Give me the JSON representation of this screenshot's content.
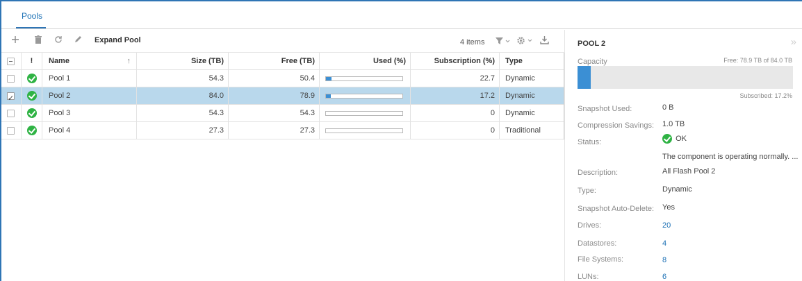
{
  "tabs": [
    {
      "label": "Pools"
    }
  ],
  "toolbar": {
    "expand_pool_label": "Expand Pool",
    "items_count": "4 items"
  },
  "table": {
    "headers": {
      "status": "!",
      "name": "Name",
      "size": "Size (TB)",
      "free": "Free (TB)",
      "used": "Used (%)",
      "subscription": "Subscription (%)",
      "type": "Type"
    },
    "sort_indicator": "↑",
    "rows": [
      {
        "name": "Pool 1",
        "size": "54.3",
        "free": "50.4",
        "used_fraction": 0.072,
        "subscription": "22.7",
        "type": "Dynamic",
        "selected": false
      },
      {
        "name": "Pool 2",
        "size": "84.0",
        "free": "78.9",
        "used_fraction": 0.061,
        "subscription": "17.2",
        "type": "Dynamic",
        "selected": true
      },
      {
        "name": "Pool 3",
        "size": "54.3",
        "free": "54.3",
        "used_fraction": 0,
        "subscription": "0",
        "type": "Dynamic",
        "selected": false
      },
      {
        "name": "Pool 4",
        "size": "27.3",
        "free": "27.3",
        "used_fraction": 0,
        "subscription": "0",
        "type": "Traditional",
        "selected": false
      }
    ]
  },
  "details": {
    "title": "POOL 2",
    "capacity_label": "Capacity",
    "capacity_free_text": "Free: 78.9 TB of 84.0 TB",
    "capacity_used_fraction": 0.061,
    "subscribed_text": "Subscribed: 17.2%",
    "fields": {
      "snapshot_used": {
        "label": "Snapshot Used:",
        "value": "0 B"
      },
      "compression": {
        "label": "Compression Savings:",
        "value": "1.0 TB"
      },
      "status": {
        "label": "Status:",
        "value": "OK",
        "description": "The component is operating normally. ..."
      },
      "description": {
        "label": "Description:",
        "value": "All Flash Pool 2"
      },
      "type": {
        "label": "Type:",
        "value": "Dynamic"
      },
      "snapshot_auto_delete": {
        "label": "Snapshot Auto-Delete:",
        "value": "Yes"
      },
      "drives": {
        "label": "Drives:",
        "value": "20"
      },
      "datastores": {
        "label": "Datastores:",
        "value": "4"
      },
      "file_systems": {
        "label": "File Systems:",
        "value": "8"
      },
      "luns": {
        "label": "LUNs:",
        "value": "6"
      }
    }
  },
  "colors": {
    "accent": "#2f75b5",
    "selected_row": "#b9d8ec",
    "ok_green": "#2fb344",
    "bar_fill": "#3b8fd4"
  }
}
